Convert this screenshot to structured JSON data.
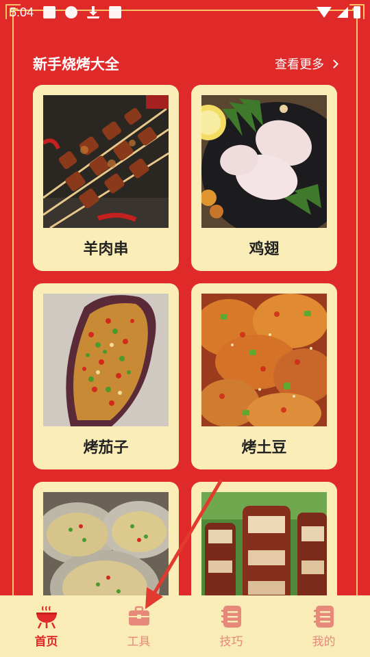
{
  "status_bar": {
    "time": "5:04",
    "icons": [
      "image-icon",
      "alert-icon",
      "download-icon",
      "font-icon",
      "wifi-icon",
      "signal-icon",
      "battery-icon"
    ]
  },
  "section": {
    "title": "新手烧烤大全",
    "see_more": "查看更多"
  },
  "cards": [
    {
      "label": "羊肉串",
      "image": "lamb-skewers-photo"
    },
    {
      "label": "鸡翅",
      "image": "chicken-wings-photo"
    },
    {
      "label": "烤茄子",
      "image": "grilled-eggplant-photo"
    },
    {
      "label": "烤土豆",
      "image": "grilled-potato-photo"
    },
    {
      "label": "",
      "image": "grilled-oysters-photo"
    },
    {
      "label": "",
      "image": "pork-belly-photo"
    }
  ],
  "nav": {
    "items": [
      {
        "label": "首页",
        "icon": "grill-icon",
        "active": true
      },
      {
        "label": "工具",
        "icon": "toolbox-icon",
        "active": false
      },
      {
        "label": "技巧",
        "icon": "notebook-icon",
        "active": false
      },
      {
        "label": "我的",
        "icon": "notebook-icon",
        "active": false
      }
    ]
  },
  "colors": {
    "background": "#e02a2a",
    "card": "#faedb8",
    "nav_background": "#f9ecb6",
    "nav_active": "#e02a2a",
    "nav_inactive": "#e6887a",
    "frame_gold": "#f5c56a"
  }
}
